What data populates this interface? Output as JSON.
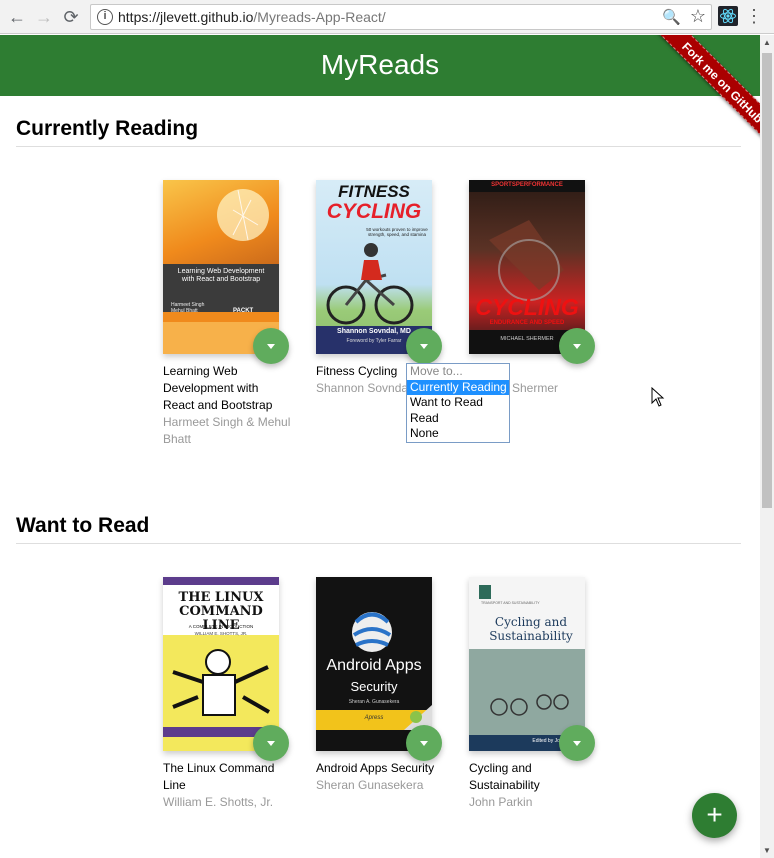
{
  "browser": {
    "back_icon": "←",
    "forward_icon": "→",
    "reload_icon": "⟳",
    "info_icon": "i",
    "url_host": "https://jlevett.github.io",
    "url_path": "/Myreads-App-React/",
    "zoom_icon": "🔍",
    "star_icon": "☆",
    "menu_icon": "⋮"
  },
  "app": {
    "title": "MyReads",
    "ribbon": "Fork me on GitHub",
    "add_button": "+"
  },
  "shelves": [
    {
      "title": "Currently Reading",
      "books": [
        {
          "title": "Learning Web Development with React and Bootstrap",
          "authors": "Harmeet Singh & Mehul Bhatt",
          "cover_title": "Learning Web Development with React and Bootstrap",
          "cover_authors": "Harmeet Singh\nMehul Bhatt",
          "cover_badge": "PACKT"
        },
        {
          "title": "Fitness Cycling",
          "authors": "Shannon Sovndal",
          "cover_title": "FITNESS",
          "cover_title2": "CYCLING",
          "cover_subtitle": "50 workouts proven to improve strength, speed, and stamina",
          "cover_authors": "Shannon Sovndal, MD",
          "cover_foreword": "Foreword by Tyler Farrar"
        },
        {
          "title": "",
          "authors": "Shermer",
          "cover_header": "SPORTSPERFORMANCE",
          "cover_title": "CYCLING",
          "cover_subtitle": "ENDURANCE AND SPEED",
          "cover_authors": "MICHAEL SHERMER"
        }
      ]
    },
    {
      "title": "Want to Read",
      "books": [
        {
          "title": "The Linux Command Line",
          "authors": "William E. Shotts, Jr.",
          "cover_title": "THE LINUX COMMAND LINE",
          "cover_subtitle": "A COMPLETE INTRODUCTION",
          "cover_authors": "WILLIAM E. SHOTTS, JR."
        },
        {
          "title": "Android Apps Security",
          "authors": "Sheran Gunasekera",
          "cover_title": "Android Apps",
          "cover_title2": "Security",
          "cover_authors": "Sheran A. Gunasekera",
          "cover_badge": "Apress"
        },
        {
          "title": "Cycling and Sustainability",
          "authors": "John Parkin",
          "cover_series": "TRANSPORT AND SUSTAINABILITY",
          "cover_title": "Cycling and Sustainability",
          "cover_authors": "Edited by John Parkin"
        }
      ]
    }
  ],
  "dropdown": {
    "options": [
      "Move to...",
      "Currently Reading",
      "Want to Read",
      "Read",
      "None"
    ],
    "selected": "Currently Reading"
  },
  "colors": {
    "header": "#2e7d32",
    "changer": "#60ac5d",
    "ribbon": "#aa0000",
    "selected": "#1e90ff"
  }
}
